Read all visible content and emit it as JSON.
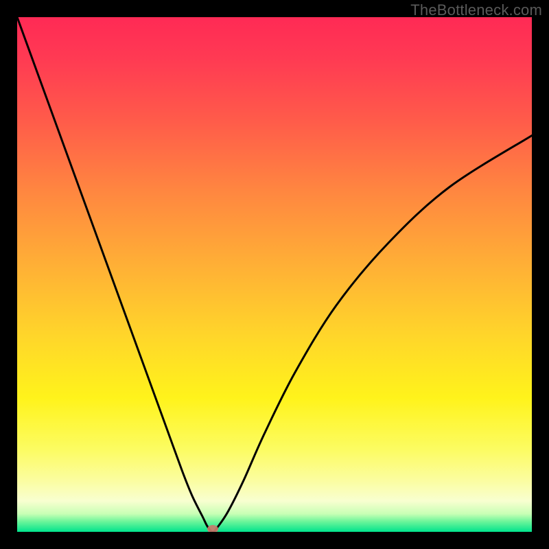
{
  "watermark": "TheBottleneck.com",
  "colors": {
    "frame": "#000000",
    "curve": "#000000",
    "marker": "#c87c6d",
    "gradient_top": "#ff2a55",
    "gradient_mid": "#ffd62a",
    "gradient_bottom": "#00e38d"
  },
  "chart_data": {
    "type": "line",
    "title": "",
    "xlabel": "",
    "ylabel": "",
    "xlim": [
      0,
      100
    ],
    "ylim": [
      0,
      100
    ],
    "grid": false,
    "legend": false,
    "annotations": {
      "marker_point": {
        "x": 38,
        "y": 0,
        "color": "#c87c6d"
      }
    },
    "series": [
      {
        "name": "bottleneck-curve",
        "x": [
          0,
          4,
          8,
          12,
          16,
          20,
          24,
          28,
          32,
          34,
          36,
          37,
          38,
          39,
          41,
          44,
          48,
          54,
          62,
          72,
          84,
          100
        ],
        "values": [
          100,
          89,
          78,
          67,
          56,
          45,
          34,
          23,
          12,
          7,
          3,
          1,
          0,
          1,
          4,
          10,
          19,
          31,
          44,
          56,
          67,
          77
        ]
      }
    ]
  }
}
